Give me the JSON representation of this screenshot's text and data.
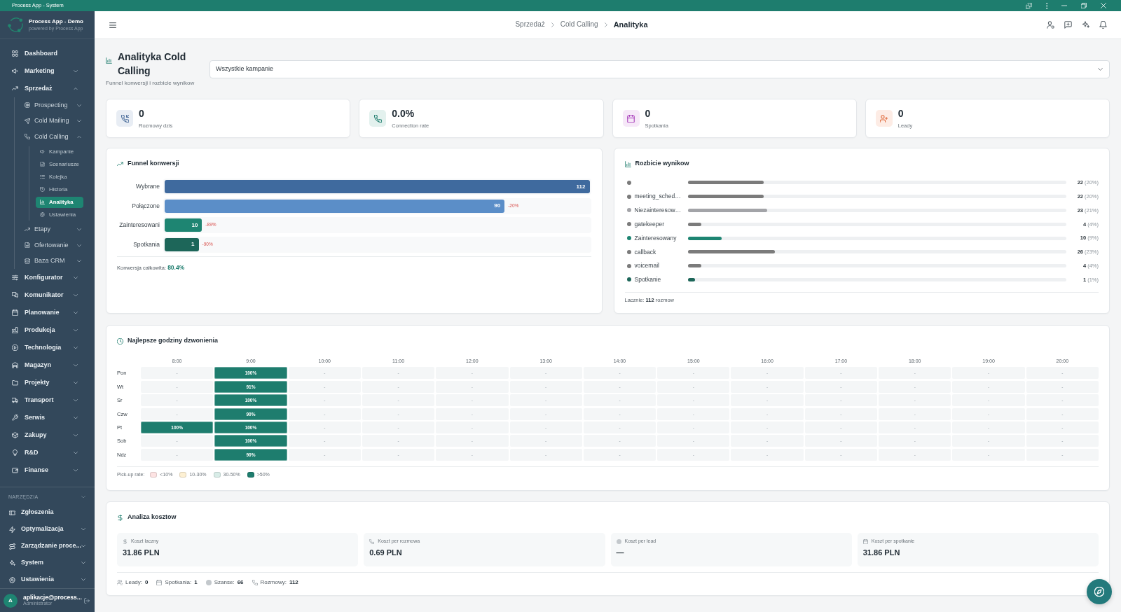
{
  "window": {
    "title": "Process App - System"
  },
  "sidebar": {
    "brand": {
      "name": "Process App - Demo",
      "tagline": "powered by Process App"
    },
    "items": [
      {
        "label": "Dashboard",
        "selected": false
      },
      {
        "label": "Marketing",
        "expanded": false,
        "selected": false
      },
      {
        "label": "Sprzedaż",
        "expanded": true,
        "selected": false,
        "children": [
          {
            "label": "Prospecting",
            "expanded": false,
            "selected": false
          },
          {
            "label": "Cold Mailing",
            "expanded": false,
            "selected": false
          },
          {
            "label": "Cold Calling",
            "expanded": true,
            "selected": false,
            "children": [
              {
                "label": "Kampanie",
                "selected": false
              },
              {
                "label": "Scenariusze",
                "selected": false
              },
              {
                "label": "Kolejka",
                "selected": false
              },
              {
                "label": "Historia",
                "selected": false
              },
              {
                "label": "Analityka",
                "selected": true
              },
              {
                "label": "Ustawienia",
                "selected": false
              }
            ]
          },
          {
            "label": "Etapy",
            "expanded": false,
            "selected": false
          },
          {
            "label": "Ofertowanie",
            "expanded": false,
            "selected": false
          },
          {
            "label": "Baza CRM",
            "expanded": false,
            "selected": false
          }
        ]
      },
      {
        "label": "Konfigurator",
        "expanded": false,
        "selected": false
      },
      {
        "label": "Komunikator",
        "expanded": false,
        "selected": false
      },
      {
        "label": "Planowanie",
        "expanded": false,
        "selected": false
      },
      {
        "label": "Produkcja",
        "expanded": false,
        "selected": false
      },
      {
        "label": "Technologia",
        "expanded": false,
        "selected": false
      },
      {
        "label": "Magazyn",
        "expanded": false,
        "selected": false
      },
      {
        "label": "Projekty",
        "expanded": false,
        "selected": false
      },
      {
        "label": "Transport",
        "expanded": false,
        "selected": false
      },
      {
        "label": "Serwis",
        "expanded": false,
        "selected": false
      },
      {
        "label": "Zakupy",
        "expanded": false,
        "selected": false
      },
      {
        "label": "R&D",
        "expanded": false,
        "selected": false
      },
      {
        "label": "Finanse",
        "expanded": false,
        "selected": false
      }
    ],
    "sections": [
      {
        "title": "NARZĘDZIA",
        "items": [
          {
            "label": "Zgłoszenia",
            "selected": false
          },
          {
            "label": "Optymalizacja",
            "expanded": false,
            "selected": false
          },
          {
            "label": "Zarządzanie proce...",
            "expanded": false,
            "selected": false
          },
          {
            "label": "System",
            "expanded": false,
            "selected": false
          },
          {
            "label": "Ustawienia",
            "expanded": false,
            "selected": false
          }
        ]
      }
    ],
    "user": {
      "initial": "A",
      "email": "aplikacje@process...",
      "role": "Administrator"
    }
  },
  "header": {
    "breadcrumb": [
      {
        "label": "Sprzedaż",
        "current": false
      },
      {
        "label": "Cold Calling",
        "current": false
      },
      {
        "label": "Analityka",
        "current": true
      }
    ]
  },
  "page": {
    "title": "Analityka Cold Calling",
    "subtitle": "Funnel konwersji i rozbicie wynikow",
    "campaign_select": {
      "value": "Wszystkie kampanie"
    }
  },
  "kpis": [
    {
      "value": "0",
      "label": "Rozmowy dzis"
    },
    {
      "value": "0.0%",
      "label": "Connection rate"
    },
    {
      "value": "0",
      "label": "Spotkania"
    },
    {
      "value": "0",
      "label": "Leady"
    }
  ],
  "funnel": {
    "title": "Funnel konwersji",
    "stages": [
      {
        "label": "Wybrane",
        "value": "112",
        "level": 1,
        "color": "#3f6a9e"
      },
      {
        "label": "Połączone",
        "value": "90",
        "drop": "-20%",
        "level": 0.8,
        "color": "#5b8ec8"
      },
      {
        "label": "Zainteresowani",
        "value": "10",
        "drop": "-89%",
        "level": 0.088,
        "color": "#1e8572"
      },
      {
        "label": "Spotkania",
        "value": "1",
        "drop": "-90%",
        "level": 0.08,
        "color": "#1d6659"
      }
    ],
    "total": "Konwersja całkowita: **80.4%**"
  },
  "breakdown": {
    "title": "Rozbicie wynikow",
    "items": [
      {
        "color": "#7b7b7b",
        "level": 0.2,
        "count": "22",
        "share": "(20%)"
      },
      {
        "label": "meeting_sched…",
        "color": "#7b7b7b",
        "level": 0.2,
        "count": "22",
        "share": "(20%)"
      },
      {
        "label": "Niezainteresow…",
        "color": "#a3a4a8",
        "level": 0.21,
        "count": "23",
        "share": "(21%)"
      },
      {
        "label": "gatekeeper",
        "color": "#7b7b7b",
        "level": 0.036,
        "count": "4",
        "share": "(4%)"
      },
      {
        "label": "Zainteresowany",
        "color": "#1e8572",
        "level": 0.09,
        "count": "10",
        "share": "(9%)"
      },
      {
        "label": "callback",
        "color": "#7b7b7b",
        "level": 0.23,
        "count": "26",
        "share": "(23%)"
      },
      {
        "label": "voicemail",
        "color": "#7b7b7b",
        "level": 0.036,
        "count": "4",
        "share": "(4%)"
      },
      {
        "label": "Spotkanie",
        "color": "#1d6659",
        "level": 0.02,
        "count": "1",
        "share": "(1%)"
      }
    ],
    "total": "Lacznie: **112** rozmow"
  },
  "heatmap": {
    "title": "Najlepsze godziny dzwonienia",
    "hours": [
      "8:00",
      "9:00",
      "10:00",
      "11:00",
      "12:00",
      "13:00",
      "14:00",
      "15:00",
      "16:00",
      "17:00",
      "18:00",
      "19:00",
      "20:00"
    ],
    "rows": [
      {
        "day": "Pon",
        "cells": [
          {
            "text": "-",
            "kind": "empty"
          },
          {
            "text": "100%",
            "kind": "high"
          },
          {
            "text": "-",
            "kind": "empty"
          },
          {
            "text": "-",
            "kind": "empty"
          },
          {
            "text": "-",
            "kind": "empty"
          },
          {
            "text": "-",
            "kind": "empty"
          },
          {
            "text": "-",
            "kind": "empty"
          },
          {
            "text": "-",
            "kind": "empty"
          },
          {
            "text": "-",
            "kind": "empty"
          },
          {
            "text": "-",
            "kind": "empty"
          },
          {
            "text": "-",
            "kind": "empty"
          },
          {
            "text": "-",
            "kind": "empty"
          },
          {
            "text": "-",
            "kind": "empty"
          }
        ]
      },
      {
        "day": "Wt",
        "cells": [
          {
            "text": "-",
            "kind": "empty"
          },
          {
            "text": "91%",
            "kind": "high"
          },
          {
            "text": "-",
            "kind": "empty"
          },
          {
            "text": "-",
            "kind": "empty"
          },
          {
            "text": "-",
            "kind": "empty"
          },
          {
            "text": "-",
            "kind": "empty"
          },
          {
            "text": "-",
            "kind": "empty"
          },
          {
            "text": "-",
            "kind": "empty"
          },
          {
            "text": "-",
            "kind": "empty"
          },
          {
            "text": "-",
            "kind": "empty"
          },
          {
            "text": "-",
            "kind": "empty"
          },
          {
            "text": "-",
            "kind": "empty"
          },
          {
            "text": "-",
            "kind": "empty"
          }
        ]
      },
      {
        "day": "Sr",
        "cells": [
          {
            "text": "-",
            "kind": "empty"
          },
          {
            "text": "100%",
            "kind": "high"
          },
          {
            "text": "-",
            "kind": "empty"
          },
          {
            "text": "-",
            "kind": "empty"
          },
          {
            "text": "-",
            "kind": "empty"
          },
          {
            "text": "-",
            "kind": "empty"
          },
          {
            "text": "-",
            "kind": "empty"
          },
          {
            "text": "-",
            "kind": "empty"
          },
          {
            "text": "-",
            "kind": "empty"
          },
          {
            "text": "-",
            "kind": "empty"
          },
          {
            "text": "-",
            "kind": "empty"
          },
          {
            "text": "-",
            "kind": "empty"
          },
          {
            "text": "-",
            "kind": "empty"
          }
        ]
      },
      {
        "day": "Czw",
        "cells": [
          {
            "text": "-",
            "kind": "empty"
          },
          {
            "text": "90%",
            "kind": "high"
          },
          {
            "text": "-",
            "kind": "empty"
          },
          {
            "text": "-",
            "kind": "empty"
          },
          {
            "text": "-",
            "kind": "empty"
          },
          {
            "text": "-",
            "kind": "empty"
          },
          {
            "text": "-",
            "kind": "empty"
          },
          {
            "text": "-",
            "kind": "empty"
          },
          {
            "text": "-",
            "kind": "empty"
          },
          {
            "text": "-",
            "kind": "empty"
          },
          {
            "text": "-",
            "kind": "empty"
          },
          {
            "text": "-",
            "kind": "empty"
          },
          {
            "text": "-",
            "kind": "empty"
          }
        ]
      },
      {
        "day": "Pt",
        "cells": [
          {
            "text": "100%",
            "kind": "high"
          },
          {
            "text": "100%",
            "kind": "high"
          },
          {
            "text": "-",
            "kind": "empty"
          },
          {
            "text": "-",
            "kind": "empty"
          },
          {
            "text": "-",
            "kind": "empty"
          },
          {
            "text": "-",
            "kind": "empty"
          },
          {
            "text": "-",
            "kind": "empty"
          },
          {
            "text": "-",
            "kind": "empty"
          },
          {
            "text": "-",
            "kind": "empty"
          },
          {
            "text": "-",
            "kind": "empty"
          },
          {
            "text": "-",
            "kind": "empty"
          },
          {
            "text": "-",
            "kind": "empty"
          },
          {
            "text": "-",
            "kind": "empty"
          }
        ]
      },
      {
        "day": "Sob",
        "cells": [
          {
            "text": "-",
            "kind": "empty"
          },
          {
            "text": "100%",
            "kind": "high"
          },
          {
            "text": "-",
            "kind": "empty"
          },
          {
            "text": "-",
            "kind": "empty"
          },
          {
            "text": "-",
            "kind": "empty"
          },
          {
            "text": "-",
            "kind": "empty"
          },
          {
            "text": "-",
            "kind": "empty"
          },
          {
            "text": "-",
            "kind": "empty"
          },
          {
            "text": "-",
            "kind": "empty"
          },
          {
            "text": "-",
            "kind": "empty"
          },
          {
            "text": "-",
            "kind": "empty"
          },
          {
            "text": "-",
            "kind": "empty"
          },
          {
            "text": "-",
            "kind": "empty"
          }
        ]
      },
      {
        "day": "Ndz",
        "cells": [
          {
            "text": "-",
            "kind": "empty"
          },
          {
            "text": "90%",
            "kind": "high"
          },
          {
            "text": "-",
            "kind": "empty"
          },
          {
            "text": "-",
            "kind": "empty"
          },
          {
            "text": "-",
            "kind": "empty"
          },
          {
            "text": "-",
            "kind": "empty"
          },
          {
            "text": "-",
            "kind": "empty"
          },
          {
            "text": "-",
            "kind": "empty"
          },
          {
            "text": "-",
            "kind": "empty"
          },
          {
            "text": "-",
            "kind": "empty"
          },
          {
            "text": "-",
            "kind": "empty"
          },
          {
            "text": "-",
            "kind": "empty"
          },
          {
            "text": "-",
            "kind": "empty"
          }
        ]
      }
    ],
    "legend_title": "Pick-up rate:",
    "legend": [
      {
        "label": "<10%",
        "kind": "low",
        "color": "#fde3e3"
      },
      {
        "label": "10-30%",
        "kind": "fair",
        "color": "#fdf0d3"
      },
      {
        "label": "30-50%",
        "kind": "mid",
        "color": "#d8ece7"
      },
      {
        "label": ">50%",
        "kind": "high",
        "color": "#1e7d6e"
      }
    ]
  },
  "costs": {
    "title": "Analiza kosztow",
    "tiles": [
      {
        "label": "Koszt laczny",
        "value": "31.86 PLN"
      },
      {
        "label": "Koszt per rozmowa",
        "value": "0.69 PLN"
      },
      {
        "label": "Koszt per lead",
        "value": "—"
      },
      {
        "label": "Koszt per spotkanie",
        "value": "31.86 PLN"
      }
    ],
    "stats": [
      {
        "label": "Leady:",
        "value": "0"
      },
      {
        "label": "Spotkania:",
        "value": "1"
      },
      {
        "label": "Szanse:",
        "value": "66"
      },
      {
        "label": "Rozmowy:",
        "value": "112"
      }
    ]
  }
}
